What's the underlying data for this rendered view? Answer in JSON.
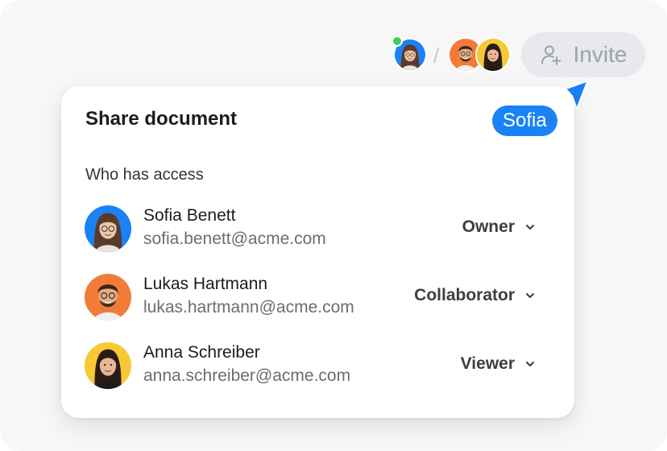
{
  "header": {
    "invite_label": "Invite",
    "divider": "/",
    "presence_status": "online"
  },
  "card": {
    "title": "Share document",
    "current_user_tag": "Sofia",
    "section_label": "Who has access",
    "members": [
      {
        "name": "Sofia Benett",
        "email": "sofia.benett@acme.com",
        "role": "Owner",
        "avatar_color": "#1a82f5"
      },
      {
        "name": "Lukas Hartmann",
        "email": "lukas.hartmann@acme.com",
        "role": "Collaborator",
        "avatar_color": "#f27b3a"
      },
      {
        "name": "Anna Schreiber",
        "email": "anna.schreiber@acme.com",
        "role": "Viewer",
        "avatar_color": "#f7c932"
      }
    ]
  },
  "colors": {
    "accent": "#1a82f5",
    "online": "#3ecf5e"
  },
  "icons": [
    "add-user-icon",
    "cursor-arrow-icon",
    "chevron-down-icon"
  ]
}
